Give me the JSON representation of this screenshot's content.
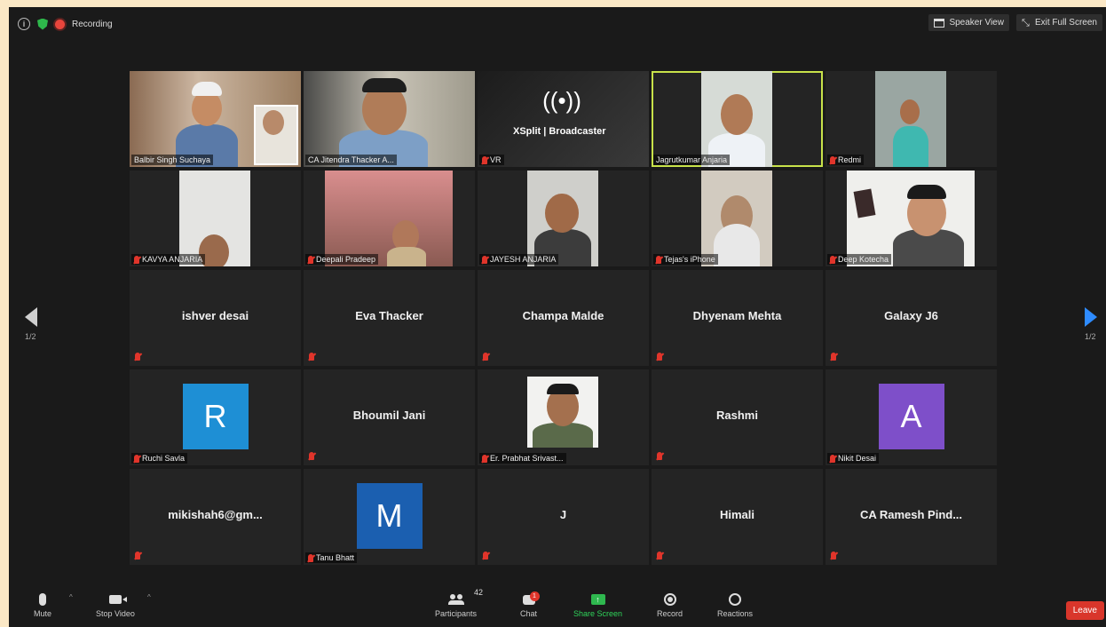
{
  "top_bar": {
    "recording_label": "Recording",
    "speaker_view_label": "Speaker View",
    "exit_full_screen_label": "Exit Full Screen"
  },
  "pagination": {
    "left": "1/2",
    "right": "1/2"
  },
  "tiles": [
    {
      "label": "Balbir Singh Suchaya",
      "mode": "video"
    },
    {
      "label": "CA Jitendra Thacker A...",
      "mode": "video"
    },
    {
      "label": "VR",
      "mode": "video",
      "screen_text": "XSplit | Broadcaster"
    },
    {
      "label": "Jagrutkumar Anjaria",
      "mode": "video",
      "active": true
    },
    {
      "label": "Redmi",
      "mode": "video"
    },
    {
      "label": "KAVYA ANJARIA",
      "mode": "video"
    },
    {
      "label": "Deepali Pradeep",
      "mode": "video"
    },
    {
      "label": "JAYESH ANJARIA",
      "mode": "video"
    },
    {
      "label": "Tejas's iPhone",
      "mode": "video"
    },
    {
      "label": "Deep Kotecha",
      "mode": "video"
    },
    {
      "name": "ishver desai",
      "mode": "name"
    },
    {
      "name": "Eva Thacker",
      "mode": "name"
    },
    {
      "name": "Champa Malde",
      "mode": "name"
    },
    {
      "name": "Dhyenam Mehta",
      "mode": "name"
    },
    {
      "name": "Galaxy J6",
      "mode": "name"
    },
    {
      "label": "Ruchi Savla",
      "mode": "avatar",
      "letter": "R",
      "color": "#1e8fd5"
    },
    {
      "name": "Bhoumil Jani",
      "mode": "name"
    },
    {
      "label": "Er. Prabhat Srivast...",
      "mode": "photo"
    },
    {
      "name": "Rashmi",
      "mode": "name"
    },
    {
      "label": "Nikit Desai",
      "mode": "avatar",
      "letter": "A",
      "color": "#7e4fc9"
    },
    {
      "name": "mikishah6@gm...",
      "mode": "name"
    },
    {
      "label": "Tanu Bhatt",
      "mode": "avatar",
      "letter": "M",
      "color": "#1b5fb0"
    },
    {
      "name": "J",
      "mode": "name"
    },
    {
      "name": "Himali",
      "mode": "name"
    },
    {
      "name": "CA Ramesh Pind...",
      "mode": "name"
    }
  ],
  "bottom_bar": {
    "mute_label": "Mute",
    "stop_video_label": "Stop Video",
    "participants_label": "Participants",
    "participants_count": "42",
    "chat_label": "Chat",
    "chat_badge": "1",
    "share_screen_label": "Share Screen",
    "record_label": "Record",
    "reactions_label": "Reactions",
    "leave_label": "Leave"
  },
  "colors": {
    "active_speaker_border": "#c8e24a",
    "share_green": "#2fb84f",
    "leave_red": "#d9362b"
  }
}
